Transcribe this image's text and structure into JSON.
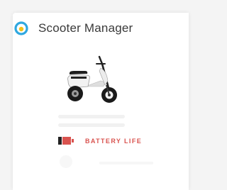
{
  "app": {
    "title": "Scooter Manager",
    "logo_icon": "eye-ring-logo-icon"
  },
  "hero": {
    "image_icon": "scooter-icon"
  },
  "battery": {
    "label": "BATTERY LIFE",
    "icon": "battery-low-icon",
    "level": 0.3,
    "color": "#d9534f"
  },
  "colors": {
    "accent_blue": "#2fa8e0",
    "accent_yellow": "#f2c318",
    "battery_red": "#d9534f"
  }
}
